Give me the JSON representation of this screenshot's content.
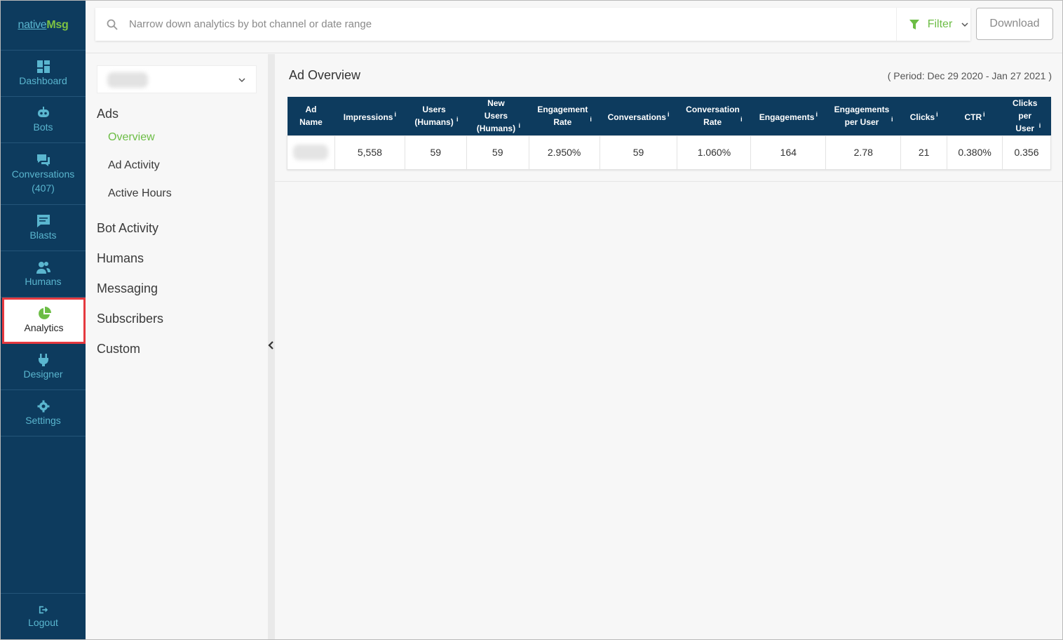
{
  "logo": {
    "part1": "native",
    "part2": "Msg"
  },
  "nav": {
    "dashboard": "Dashboard",
    "bots": "Bots",
    "conversations": "Conversations",
    "conversations_count": "(407)",
    "blasts": "Blasts",
    "humans": "Humans",
    "analytics": "Analytics",
    "designer": "Designer",
    "settings": "Settings",
    "logout": "Logout"
  },
  "topbar": {
    "search_placeholder": "Narrow down analytics by bot channel or date range",
    "filter_label": "Filter",
    "download_label": "Download"
  },
  "subnav": {
    "ads": "Ads",
    "overview": "Overview",
    "ad_activity": "Ad Activity",
    "active_hours": "Active Hours",
    "bot_activity": "Bot Activity",
    "humans": "Humans",
    "messaging": "Messaging",
    "subscribers": "Subscribers",
    "custom": "Custom"
  },
  "main": {
    "title": "Ad Overview",
    "period": "( Period: Dec 29 2020 - Jan 27 2021 )",
    "columns": [
      "Ad Name",
      "Impressions",
      "Users (Humans)",
      "New Users (Humans)",
      "Engagement Rate",
      "Conversations",
      "Conversation Rate",
      "Engagements",
      "Engagements per User",
      "Clicks",
      "CTR",
      "Clicks per User"
    ],
    "info_mark": "i",
    "row": {
      "impressions": "5,558",
      "users": "59",
      "new_users": "59",
      "engagement_rate": "2.950%",
      "conversations": "59",
      "conversation_rate": "1.060%",
      "engagements": "164",
      "engagements_per_user": "2.78",
      "clicks": "21",
      "ctr": "0.380%",
      "clicks_per_user": "0.356"
    }
  },
  "colors": {
    "nav_bg": "#0d3b5e",
    "nav_text": "#5ab6cf",
    "accent_green": "#6cbd45",
    "highlight_red": "#e5393f"
  }
}
